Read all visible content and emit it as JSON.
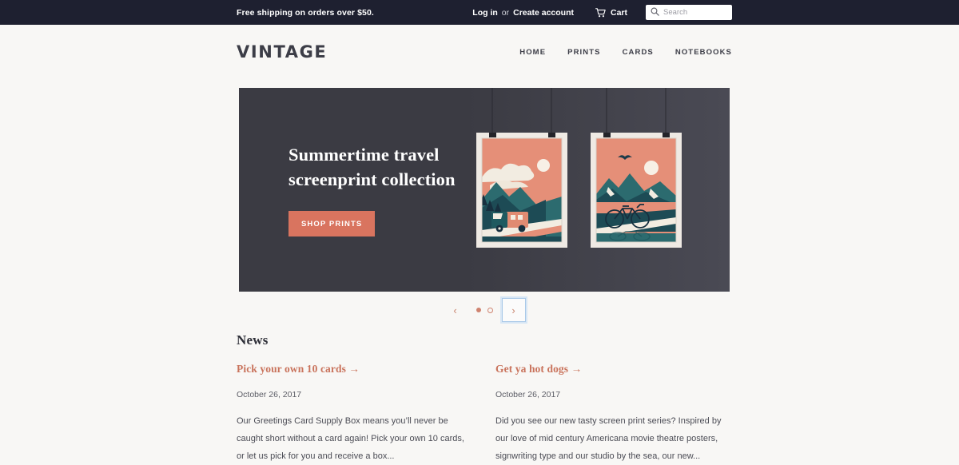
{
  "announcement": {
    "shipping_message": "Free shipping on orders over $50.",
    "login_label": "Log in",
    "or_label": "or",
    "create_account_label": "Create account",
    "cart_label": "Cart",
    "cart_icon": "shopping-cart-icon",
    "search_icon": "search-icon",
    "search_placeholder": "Search",
    "search_value": "",
    "bar_color": "#1e2030"
  },
  "header": {
    "logo": "VINTAGE",
    "nav": [
      {
        "label": "Home"
      },
      {
        "label": "Prints"
      },
      {
        "label": "Cards"
      },
      {
        "label": "Notebooks"
      }
    ]
  },
  "hero": {
    "title_line1": "Summertime travel",
    "title_line2": "screenprint collection",
    "button_label": "Shop prints",
    "background_color": "#3b3b43",
    "accent_color": "#d9745f",
    "image_alt": "two-hanging-travel-screenprint-posters"
  },
  "slideshow": {
    "prev_icon": "chevron-left-icon",
    "next_icon": "chevron-right-icon",
    "slides": [
      {
        "active": true
      },
      {
        "active": false
      }
    ],
    "focus_ring_color": "#a9c9e8",
    "dot_color": "#cf8370"
  },
  "news": {
    "heading": "News",
    "articles": [
      {
        "title": "Pick your own 10 cards →",
        "date": "October 26, 2017",
        "excerpt": "Our Greetings Card Supply Box means you’ll never be caught short without a card again! Pick your own 10 cards, or let us pick for you and receive a box..."
      },
      {
        "title": "Get ya hot dogs →",
        "date": "October 26, 2017",
        "excerpt": "Did you see our new tasty screen print series? Inspired by our love of mid century Americana movie theatre posters, signwriting type and our studio by the sea, our new..."
      }
    ]
  }
}
